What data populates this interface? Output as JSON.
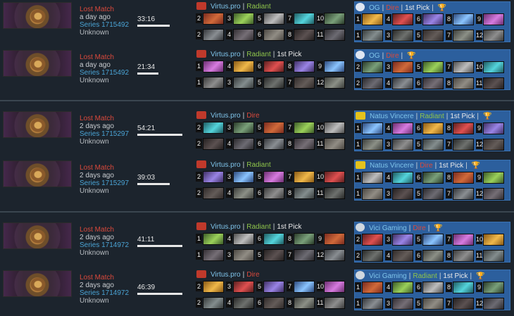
{
  "matches": [
    {
      "result": "Lost Match",
      "ago": "a day ago",
      "series": "Series 1715492",
      "skill": "Unknown",
      "duration": "33:16",
      "duration_fraction": 0.72,
      "left": {
        "name": "Virtus.pro",
        "side": "Radiant",
        "pick": "",
        "trophy": false
      },
      "right": {
        "name": "OG",
        "side": "Dire",
        "pick": "1st Pick",
        "trophy": true
      },
      "left_picks": [
        "2",
        "3",
        "5",
        "7",
        "10"
      ],
      "left_bans": [
        "2",
        "4",
        "6",
        "8",
        "11"
      ],
      "right_picks": [
        "1",
        "4",
        "6",
        "8",
        "9"
      ],
      "right_bans": [
        "1",
        "3",
        "5",
        "7",
        "12"
      ]
    },
    {
      "result": "Lost Match",
      "ago": "a day ago",
      "series": "Series 1715492",
      "skill": "Unknown",
      "duration": "21:34",
      "duration_fraction": 0.47,
      "left": {
        "name": "Virtus.pro",
        "side": "Radiant",
        "pick": "1st Pick",
        "trophy": false
      },
      "right": {
        "name": "OG",
        "side": "Dire",
        "pick": "",
        "trophy": true
      },
      "left_picks": [
        "1",
        "4",
        "6",
        "8",
        "9"
      ],
      "left_bans": [
        "1",
        "3",
        "5",
        "7",
        "12"
      ],
      "right_picks": [
        "2",
        "3",
        "5",
        "7",
        "10"
      ],
      "right_bans": [
        "2",
        "4",
        "6",
        "8",
        "11"
      ]
    },
    {
      "result": "Lost Match",
      "ago": "2 days ago",
      "series": "Series 1715297",
      "skill": "Unknown",
      "duration": "54:21",
      "duration_fraction": 1.0,
      "left": {
        "name": "Virtus.pro",
        "side": "Dire",
        "pick": "",
        "trophy": false
      },
      "right": {
        "name": "Natus Vincere",
        "side": "Radiant",
        "pick": "1st Pick",
        "trophy": true
      },
      "left_picks": [
        "2",
        "3",
        "5",
        "7",
        "10"
      ],
      "left_bans": [
        "2",
        "4",
        "6",
        "8",
        "11"
      ],
      "right_picks": [
        "1",
        "4",
        "6",
        "8",
        "9"
      ],
      "right_bans": [
        "1",
        "3",
        "5",
        "7",
        "12"
      ]
    },
    {
      "result": "Lost Match",
      "ago": "2 days ago",
      "series": "Series 1715297",
      "skill": "Unknown",
      "duration": "39:03",
      "duration_fraction": 0.72,
      "left": {
        "name": "Virtus.pro",
        "side": "Radiant",
        "pick": "",
        "trophy": false
      },
      "right": {
        "name": "Natus Vincere",
        "side": "Dire",
        "pick": "1st Pick",
        "trophy": true
      },
      "left_picks": [
        "2",
        "3",
        "5",
        "7",
        "10"
      ],
      "left_bans": [
        "2",
        "4",
        "6",
        "8",
        "11"
      ],
      "right_picks": [
        "1",
        "4",
        "6",
        "8",
        "9"
      ],
      "right_bans": [
        "1",
        "3",
        "5",
        "7",
        "12"
      ]
    },
    {
      "result": "Lost Match",
      "ago": "2 days ago",
      "series": "Series 1714972",
      "skill": "Unknown",
      "duration": "41:11",
      "duration_fraction": 1.0,
      "left": {
        "name": "Virtus.pro",
        "side": "Radiant",
        "pick": "1st Pick",
        "trophy": false
      },
      "right": {
        "name": "Vici Gaming",
        "side": "Dire",
        "pick": "",
        "trophy": true
      },
      "left_picks": [
        "1",
        "4",
        "6",
        "8",
        "9"
      ],
      "left_bans": [
        "1",
        "3",
        "5",
        "7",
        "12"
      ],
      "right_picks": [
        "2",
        "3",
        "5",
        "7",
        "10"
      ],
      "right_bans": [
        "2",
        "4",
        "6",
        "8",
        "11"
      ]
    },
    {
      "result": "Lost Match",
      "ago": "2 days ago",
      "series": "Series 1714972",
      "skill": "Unknown",
      "duration": "46:39",
      "duration_fraction": 1.0,
      "left": {
        "name": "Virtus.pro",
        "side": "Dire",
        "pick": "",
        "trophy": false
      },
      "right": {
        "name": "Vici Gaming",
        "side": "Radiant",
        "pick": "1st Pick",
        "trophy": true
      },
      "left_picks": [
        "2",
        "3",
        "5",
        "7",
        "10"
      ],
      "left_bans": [
        "2",
        "4",
        "6",
        "8",
        "11"
      ],
      "right_picks": [
        "1",
        "4",
        "6",
        "8",
        "9"
      ],
      "right_bans": [
        "1",
        "3",
        "5",
        "7",
        "12"
      ]
    }
  ],
  "colors": {
    "background": "#1c242d",
    "winner_panel": "#2c5f9d",
    "lost": "#d9493c",
    "series": "#4aa3d4",
    "radiant": "#8ec44b",
    "dire": "#d9493c",
    "team_name": "#7fc4ea"
  },
  "icons": {
    "team_logo": "team-logo-icon",
    "trophy": "trophy-icon",
    "match_thumbnail": "tournament-banner"
  }
}
